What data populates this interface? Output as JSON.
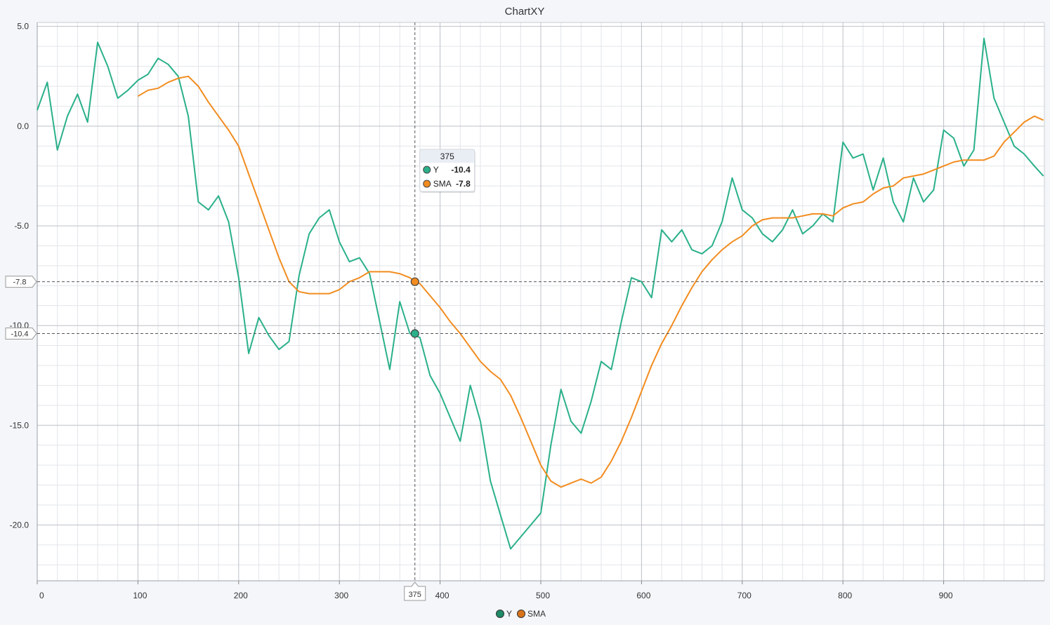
{
  "chart_data": {
    "type": "line",
    "title": "ChartXY",
    "xlim": [
      0,
      1000
    ],
    "ylim": [
      -22.8,
      5.2
    ],
    "x_ticks": [
      0,
      100,
      200,
      300,
      400,
      500,
      600,
      700,
      800,
      900
    ],
    "y_ticks": [
      5,
      0,
      -5,
      -10,
      -15,
      -20
    ],
    "y_tick_labels": [
      "5.0",
      "0.0",
      "-5.0",
      "-10.0",
      "-15.0",
      "-20.0"
    ],
    "grid": true,
    "legend_position": "bottom-center",
    "series": [
      {
        "name": "Y",
        "color": "#2ab08a",
        "x": [
          0,
          10,
          20,
          30,
          40,
          50,
          60,
          70,
          80,
          90,
          100,
          110,
          120,
          130,
          140,
          150,
          160,
          170,
          180,
          190,
          200,
          210,
          220,
          230,
          240,
          250,
          260,
          270,
          280,
          290,
          300,
          310,
          320,
          330,
          340,
          350,
          360,
          370,
          380,
          390,
          400,
          410,
          420,
          430,
          440,
          450,
          460,
          470,
          480,
          490,
          500,
          510,
          520,
          530,
          540,
          550,
          560,
          570,
          580,
          590,
          600,
          610,
          620,
          630,
          640,
          650,
          660,
          670,
          680,
          690,
          700,
          710,
          720,
          730,
          740,
          750,
          760,
          770,
          780,
          790,
          800,
          810,
          820,
          830,
          840,
          850,
          860,
          870,
          880,
          890,
          900,
          910,
          920,
          930,
          940,
          950,
          960,
          970,
          980,
          990,
          999
        ],
        "values": [
          0.8,
          2.2,
          -1.2,
          0.5,
          1.6,
          0.2,
          4.2,
          3.0,
          1.4,
          1.8,
          2.3,
          2.6,
          3.4,
          3.1,
          2.5,
          0.5,
          -3.8,
          -4.2,
          -3.5,
          -4.8,
          -7.6,
          -11.4,
          -9.6,
          -10.5,
          -11.2,
          -10.8,
          -7.5,
          -5.4,
          -4.6,
          -4.2,
          -5.8,
          -6.8,
          -6.6,
          -7.4,
          -9.8,
          -12.2,
          -8.8,
          -10.4,
          -10.6,
          -12.5,
          -13.4,
          -14.6,
          -15.8,
          -13.0,
          -14.8,
          -17.8,
          -19.5,
          -21.2,
          -20.6,
          -20.0,
          -19.4,
          -16.0,
          -13.2,
          -14.8,
          -15.4,
          -13.8,
          -11.8,
          -12.2,
          -9.8,
          -7.6,
          -7.8,
          -8.6,
          -5.2,
          -5.8,
          -5.2,
          -6.2,
          -6.4,
          -6.0,
          -4.8,
          -2.6,
          -4.2,
          -4.6,
          -5.4,
          -5.8,
          -5.2,
          -4.2,
          -5.4,
          -5.0,
          -4.4,
          -4.8,
          -0.8,
          -1.6,
          -1.4,
          -3.2,
          -1.6,
          -3.8,
          -4.8,
          -2.6,
          -3.8,
          -3.2,
          -0.2,
          -0.6,
          -2.0,
          -1.2,
          4.4,
          1.4,
          0.2,
          -1.0,
          -1.4,
          -2.0,
          -2.5
        ]
      },
      {
        "name": "SMA",
        "color": "#f28c1f",
        "x": [
          100,
          110,
          120,
          130,
          140,
          150,
          160,
          170,
          180,
          190,
          200,
          210,
          220,
          230,
          240,
          250,
          260,
          270,
          280,
          290,
          300,
          310,
          320,
          330,
          340,
          350,
          360,
          370,
          375,
          380,
          390,
          400,
          410,
          420,
          430,
          440,
          450,
          460,
          470,
          480,
          490,
          500,
          510,
          520,
          530,
          540,
          550,
          560,
          570,
          580,
          590,
          600,
          610,
          620,
          630,
          640,
          650,
          660,
          670,
          680,
          690,
          700,
          710,
          720,
          730,
          740,
          750,
          760,
          770,
          780,
          790,
          800,
          810,
          820,
          830,
          840,
          850,
          860,
          870,
          880,
          890,
          900,
          910,
          920,
          930,
          940,
          950,
          960,
          970,
          980,
          990,
          999
        ],
        "values": [
          1.5,
          1.8,
          1.9,
          2.2,
          2.4,
          2.5,
          2.0,
          1.2,
          0.5,
          -0.2,
          -1.0,
          -2.4,
          -3.8,
          -5.2,
          -6.6,
          -7.8,
          -8.3,
          -8.4,
          -8.4,
          -8.4,
          -8.2,
          -7.8,
          -7.6,
          -7.3,
          -7.3,
          -7.3,
          -7.4,
          -7.6,
          -7.8,
          -7.9,
          -8.5,
          -9.1,
          -9.8,
          -10.4,
          -11.1,
          -11.8,
          -12.3,
          -12.7,
          -13.5,
          -14.6,
          -15.8,
          -17.0,
          -17.8,
          -18.1,
          -17.9,
          -17.7,
          -17.9,
          -17.6,
          -16.8,
          -15.8,
          -14.6,
          -13.3,
          -12.0,
          -10.9,
          -10.0,
          -9.0,
          -8.1,
          -7.3,
          -6.7,
          -6.2,
          -5.8,
          -5.5,
          -5.0,
          -4.7,
          -4.6,
          -4.6,
          -4.6,
          -4.5,
          -4.4,
          -4.4,
          -4.5,
          -4.1,
          -3.9,
          -3.8,
          -3.4,
          -3.1,
          -3.0,
          -2.6,
          -2.5,
          -2.4,
          -2.2,
          -2.0,
          -1.8,
          -1.7,
          -1.7,
          -1.7,
          -1.5,
          -0.8,
          -0.3,
          0.2,
          0.5,
          0.3
        ]
      }
    ],
    "cursor": {
      "x": 375,
      "x_label": "375",
      "y_labels": [
        "-7.8",
        "-10.4"
      ],
      "tooltip": {
        "title": "375",
        "rows": [
          {
            "name": "Y",
            "value": "-10.4",
            "color": "#2ab08a"
          },
          {
            "name": "SMA",
            "value": "-7.8",
            "color": "#f28c1f"
          }
        ]
      }
    }
  }
}
